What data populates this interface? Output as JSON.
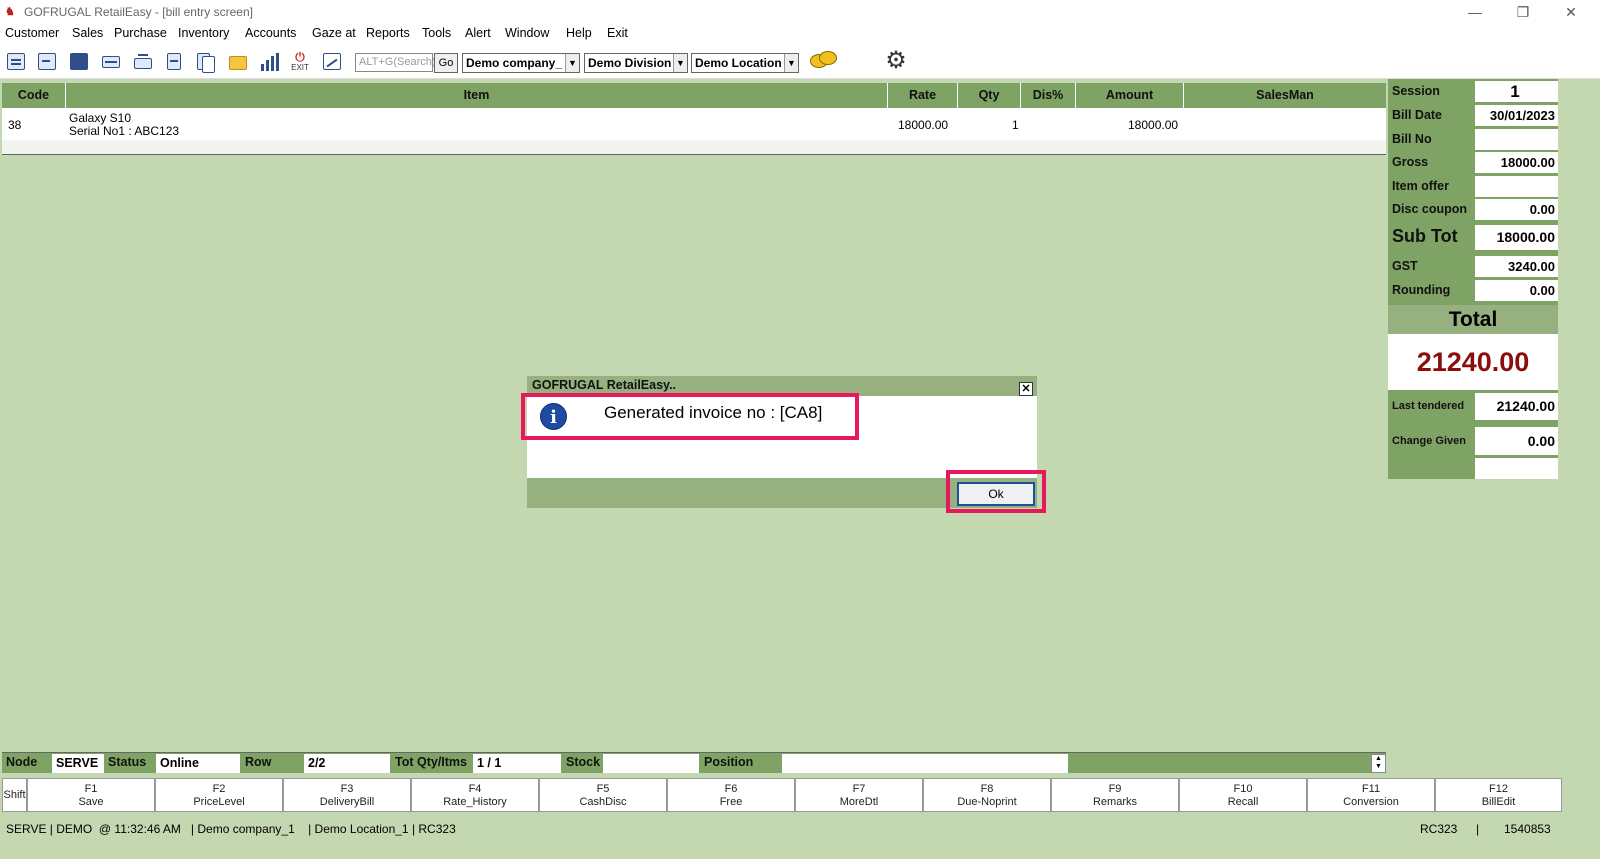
{
  "window": {
    "title": "GOFRUGAL RetailEasy - [bill entry screen]",
    "app_icon": "app-icon"
  },
  "menu": [
    "Customer",
    "Sales",
    "Purchase",
    "Inventory",
    "Accounts",
    "Gaze at",
    "Reports",
    "Tools",
    "Alert",
    "Window",
    "Help",
    "Exit"
  ],
  "toolbar": {
    "exit_label": "EXIT",
    "search_placeholder": "ALT+G(Search)",
    "go_label": "Go",
    "company": "Demo company_",
    "division": "Demo Division",
    "location": "Demo Location"
  },
  "grid": {
    "headers": [
      "Code",
      "Item",
      "Rate",
      "Qty",
      "Dis%",
      "Amount",
      "SalesMan"
    ],
    "rows": [
      {
        "code": "38",
        "item": "Galaxy S10",
        "serial": "Serial No1 : ABC123",
        "rate": "18000.00",
        "qty": "1",
        "dis": "",
        "amount": "18000.00",
        "salesman": ""
      }
    ]
  },
  "summary": {
    "session_label": "Session",
    "session": "1",
    "bill_date_label": "Bill Date",
    "bill_date": "30/01/2023",
    "bill_no_label": "Bill No",
    "bill_no": "",
    "gross_label": "Gross",
    "gross": "18000.00",
    "item_offer_label": "Item offer",
    "item_offer": "",
    "disc_coupon_label": "Disc coupon",
    "disc_coupon": "0.00",
    "sub_tot_label": "Sub Tot",
    "sub_tot": "18000.00",
    "gst_label": "GST",
    "gst": "3240.00",
    "rounding_label": "Rounding",
    "rounding": "0.00",
    "total_label": "Total",
    "total": "21240.00",
    "last_tendered_label": "Last tendered",
    "last_tendered": "21240.00",
    "change_given_label": "Change Given",
    "change_given": "0.00"
  },
  "dialog": {
    "title": "GOFRUGAL RetailEasy..",
    "message": "Generated invoice no : [CA8]",
    "ok_label": "Ok",
    "icon": "info-icon"
  },
  "status_row": {
    "node_label": "Node",
    "node": "SERVE",
    "status_label": "Status",
    "status": "Online",
    "row_label": "Row",
    "row": "2/2",
    "tot_label": "Tot Qty/Itms",
    "tot": "1 / 1",
    "stock_label": "Stock",
    "stock": "",
    "position_label": "Position",
    "position": ""
  },
  "fkeys": [
    {
      "key": "Shift",
      "label": ""
    },
    {
      "key": "F1",
      "label": "Save"
    },
    {
      "key": "F2",
      "label": "PriceLevel"
    },
    {
      "key": "F3",
      "label": "DeliveryBill"
    },
    {
      "key": "F4",
      "label": "Rate_History"
    },
    {
      "key": "F5",
      "label": "CashDisc"
    },
    {
      "key": "F6",
      "label": "Free"
    },
    {
      "key": "F7",
      "label": "MoreDtl"
    },
    {
      "key": "F8",
      "label": "Due-Noprint"
    },
    {
      "key": "F9",
      "label": "Remarks"
    },
    {
      "key": "F10",
      "label": "Recall"
    },
    {
      "key": "F11",
      "label": "Conversion"
    },
    {
      "key": "F12",
      "label": "BillEdit"
    }
  ],
  "bottom_status": {
    "left": "SERVE | DEMO  @ 11:32:46 AM   | Demo company_1    | Demo Location_1 | RC323",
    "right1": "RC323",
    "right2": "1540853"
  },
  "colors": {
    "accent_green": "#7fa364",
    "background": "#c3d7b0",
    "highlight": "#e8195a",
    "total_red": "#8b0e0e"
  }
}
